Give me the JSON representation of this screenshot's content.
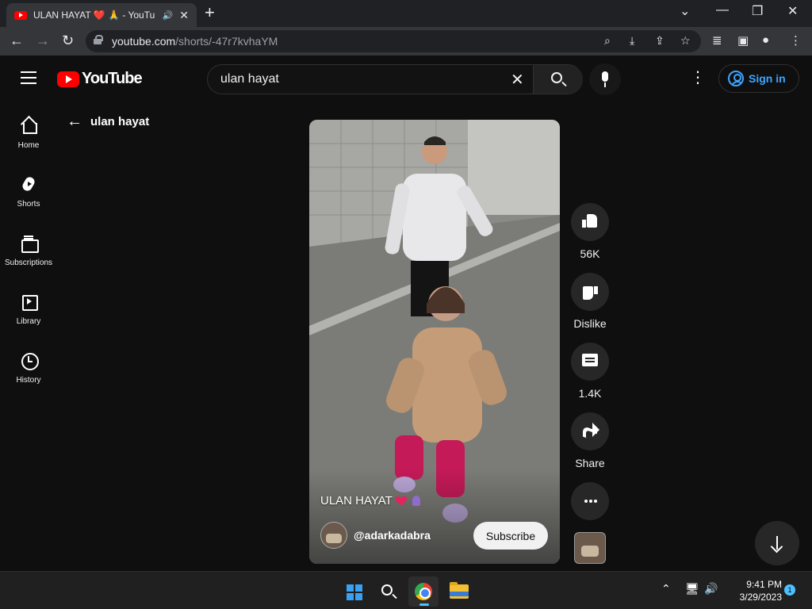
{
  "browser": {
    "tab_title": "ULAN HAYAT ❤️ 🙏 - YouTu",
    "url_host": "youtube.com",
    "url_path": "/shorts/-47r7kvhaYM"
  },
  "masthead": {
    "logo_text": "YouTube",
    "search_query": "ulan hayat",
    "signin_label": "Sign in"
  },
  "guide": {
    "items": [
      {
        "label": "Home",
        "icon": "home-icon"
      },
      {
        "label": "Shorts",
        "icon": "shorts-icon"
      },
      {
        "label": "Subscriptions",
        "icon": "subscriptions-icon"
      },
      {
        "label": "Library",
        "icon": "library-icon"
      },
      {
        "label": "History",
        "icon": "history-icon"
      }
    ]
  },
  "page": {
    "back_title": "ulan hayat"
  },
  "short": {
    "caption": "ULAN HAYAT",
    "channel": "@adarkadabra",
    "subscribe_label": "Subscribe"
  },
  "actions": {
    "like_count": "56K",
    "dislike_label": "Dislike",
    "comment_count": "1.4K",
    "share_label": "Share"
  },
  "taskbar": {
    "time": "9:41 PM",
    "date": "3/29/2023",
    "notification_count": "1"
  },
  "colors": {
    "youtube_red": "#ff0000",
    "link_blue": "#3ea6ff",
    "background": "#0f0f0f"
  }
}
